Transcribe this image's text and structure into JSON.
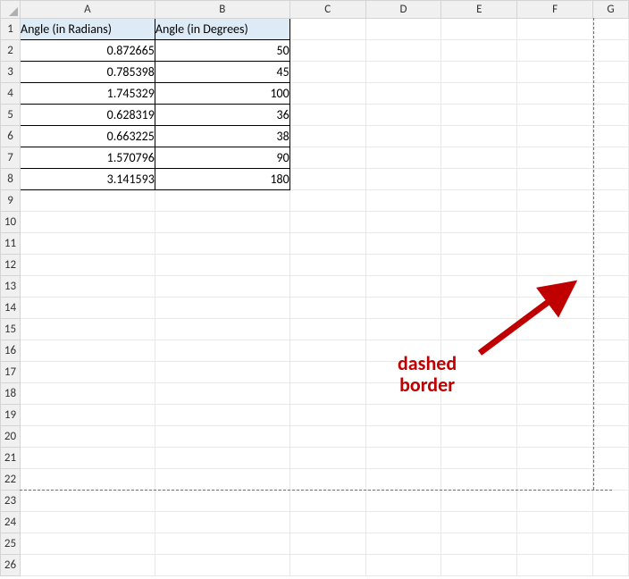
{
  "columns": [
    "A",
    "B",
    "C",
    "D",
    "E",
    "F",
    "G"
  ],
  "rowCount": 26,
  "headers": {
    "A": "Angle (in Radians)",
    "B": "Angle (in Degrees)"
  },
  "data": [
    {
      "A": "0.872665",
      "B": "50"
    },
    {
      "A": "0.785398",
      "B": "45"
    },
    {
      "A": "1.745329",
      "B": "100"
    },
    {
      "A": "0.628319",
      "B": "36"
    },
    {
      "A": "0.663225",
      "B": "38"
    },
    {
      "A": "1.570796",
      "B": "90"
    },
    {
      "A": "3.141593",
      "B": "180"
    }
  ],
  "annotation": {
    "line1": "dashed",
    "line2": "border"
  }
}
